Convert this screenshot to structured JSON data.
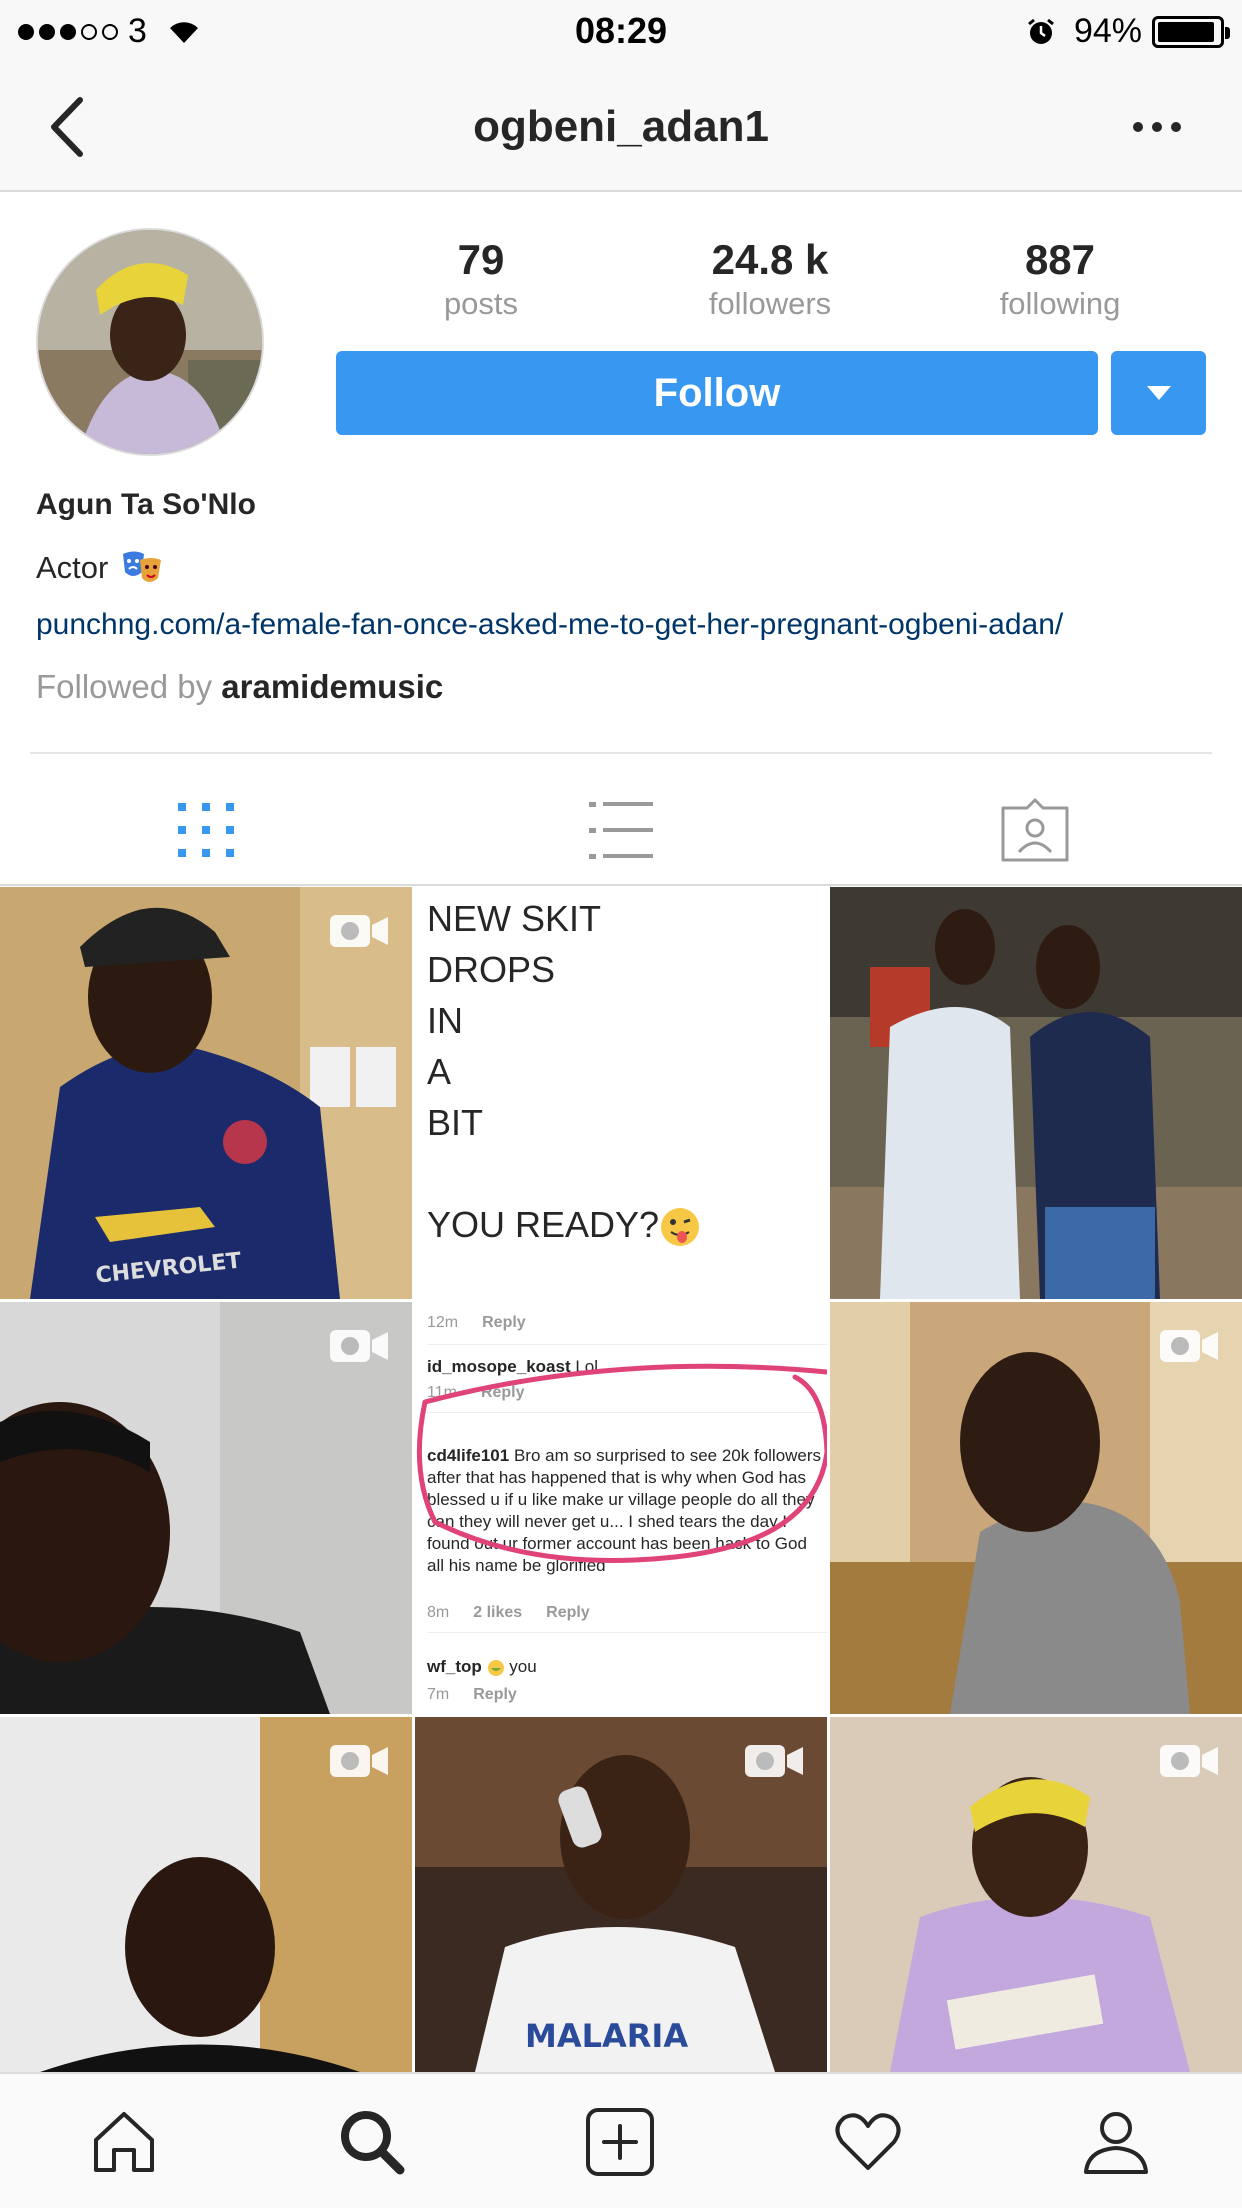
{
  "status_bar": {
    "carrier": "3",
    "time": "08:29",
    "battery": "94%",
    "battery_level": 0.94
  },
  "nav": {
    "title": "ogbeni_adan1"
  },
  "profile": {
    "stats": {
      "posts_count": "79",
      "posts_label": "posts",
      "followers_count": "24.8 k",
      "followers_label": "followers",
      "following_count": "887",
      "following_label": "following"
    },
    "follow_label": "Follow",
    "name": "Agun Ta So'Nlo",
    "bio": "Actor",
    "link": "punchng.com/a-female-fan-once-asked-me-to-get-her-pregnant-ogbeni-adan/",
    "followed_by_prefix": "Followed by",
    "followed_by_user": "aramidemusic"
  },
  "colors": {
    "accent": "#3897f0",
    "link": "#003569",
    "muted": "#999999",
    "active_tab": "#3897f0"
  },
  "posts": {
    "skit_post": {
      "text": "NEW SKIT\nDROPS\nIN\nA\nBIT\n\nYOU READY?"
    },
    "comments_post": {
      "c0_time": "12m",
      "reply": "Reply",
      "c1_user": "id_mosope_koast",
      "c1_text": "Lol",
      "c1_time": "11m",
      "c2_user": "cd4life101",
      "c2_text": "Bro am so surprised to see 20k followers after that has happened that is  why when God has blessed u if u like make ur village people do all they can they will never get u... I shed tears the day I found out ur former account has been hack to God all his name be glorified",
      "c2_time": "8m",
      "c2_likes": "2 likes",
      "c3_user": "wf_top",
      "c3_text": "you",
      "c3_time": "7m"
    },
    "shirt_text": "CHEVROLET",
    "malaria_text": "MALARIA"
  },
  "icons": {
    "back": "chevron-left-icon",
    "more": "ellipsis-icon",
    "grid": "grid-icon",
    "list": "list-icon",
    "tagged": "tagged-icon",
    "home": "home-icon",
    "search": "search-icon",
    "add": "add-post-icon",
    "activity": "heart-icon",
    "profile": "profile-icon",
    "video": "video-camera-icon"
  }
}
